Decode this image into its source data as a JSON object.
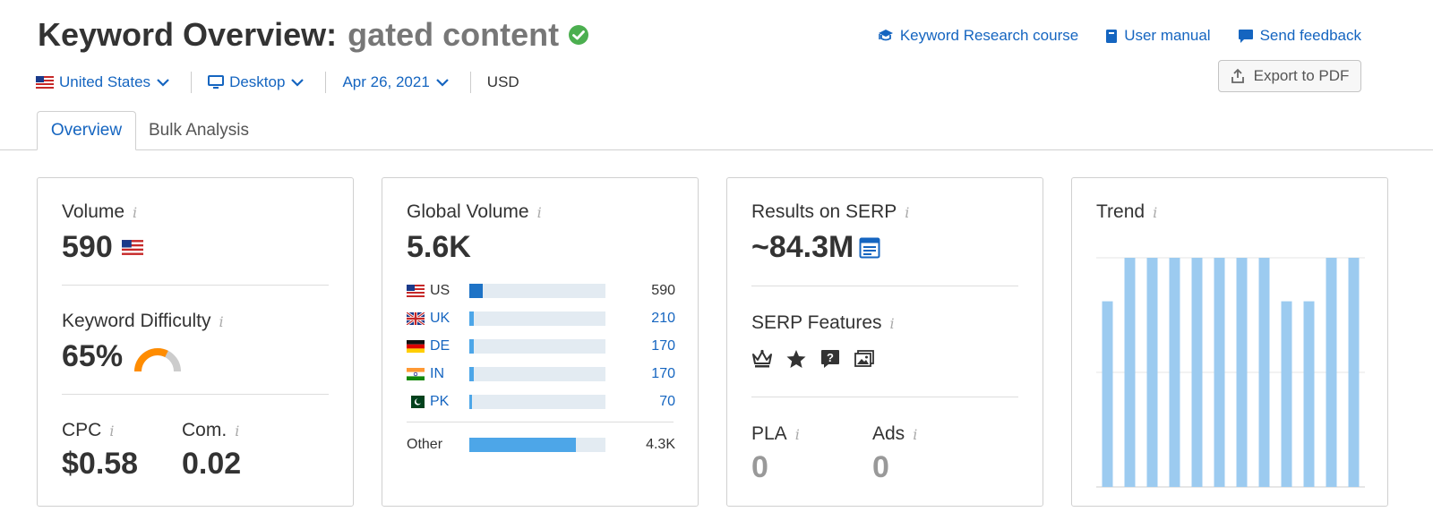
{
  "header": {
    "title": "Keyword Overview:",
    "keyword": "gated content"
  },
  "filters": {
    "database": "United States",
    "device": "Desktop",
    "date": "Apr 26, 2021",
    "currency": "USD"
  },
  "links": {
    "course": "Keyword Research course",
    "manual": "User manual",
    "feedback": "Send feedback",
    "export": "Export to PDF"
  },
  "tabs": [
    {
      "label": "Overview",
      "active": true
    },
    {
      "label": "Bulk Analysis",
      "active": false
    }
  ],
  "volume_card": {
    "volume_label": "Volume",
    "volume_value": "590",
    "kd_label": "Keyword Difficulty",
    "kd_value": "65%",
    "kd_percent": 65,
    "cpc_label": "CPC",
    "cpc_value": "$0.58",
    "com_label": "Com.",
    "com_value": "0.02"
  },
  "global_card": {
    "label": "Global Volume",
    "value": "5.6K",
    "countries": [
      {
        "code": "US",
        "value": "590",
        "fraction": 0.1
      },
      {
        "code": "UK",
        "value": "210",
        "fraction": 0.035
      },
      {
        "code": "DE",
        "value": "170",
        "fraction": 0.03
      },
      {
        "code": "IN",
        "value": "170",
        "fraction": 0.03
      },
      {
        "code": "PK",
        "value": "70",
        "fraction": 0.02
      }
    ],
    "other_label": "Other",
    "other_value": "4.3K",
    "other_fraction": 0.78
  },
  "serp_card": {
    "results_label": "Results on SERP",
    "results_value": "~84.3M",
    "features_label": "SERP Features",
    "features": [
      "crown-icon",
      "star-icon",
      "question-icon",
      "image-icon"
    ],
    "pla_label": "PLA",
    "pla_value": "0",
    "ads_label": "Ads",
    "ads_value": "0"
  },
  "trend_card": {
    "label": "Trend"
  },
  "chart_data": {
    "type": "bar",
    "title": "Trend",
    "values": [
      0.81,
      1,
      1,
      1,
      1,
      1,
      1,
      1,
      0.81,
      0.81,
      1,
      1
    ],
    "ylim": [
      0,
      1
    ],
    "grid": true
  },
  "colors": {
    "accent": "#1565c0",
    "bar": "#9ccbf0",
    "kd_arc": "#ff8c00",
    "check": "#4caf50"
  }
}
